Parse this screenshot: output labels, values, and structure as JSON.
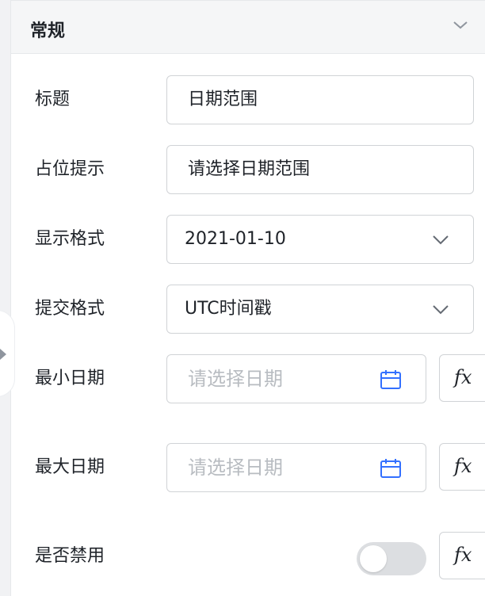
{
  "section": {
    "title": "常规"
  },
  "fields": {
    "title": {
      "label": "标题",
      "value": "日期范围"
    },
    "placeholder": {
      "label": "占位提示",
      "value": "请选择日期范围"
    },
    "display_format": {
      "label": "显示格式",
      "value": "2021-01-10"
    },
    "submit_format": {
      "label": "提交格式",
      "value": "UTC时间戳"
    },
    "min_date": {
      "label": "最小日期",
      "placeholder": "请选择日期"
    },
    "max_date": {
      "label": "最大日期",
      "placeholder": "请选择日期"
    },
    "disabled": {
      "label": "是否禁用",
      "checked": false
    }
  },
  "fx_label": "fx",
  "colors": {
    "accent": "#3370ff",
    "border": "#d0d3d6",
    "header_bg": "#f5f6f7"
  },
  "icons": [
    "chevron-up-icon",
    "chevron-down-icon",
    "calendar-icon",
    "collapse-arrow-icon"
  ]
}
